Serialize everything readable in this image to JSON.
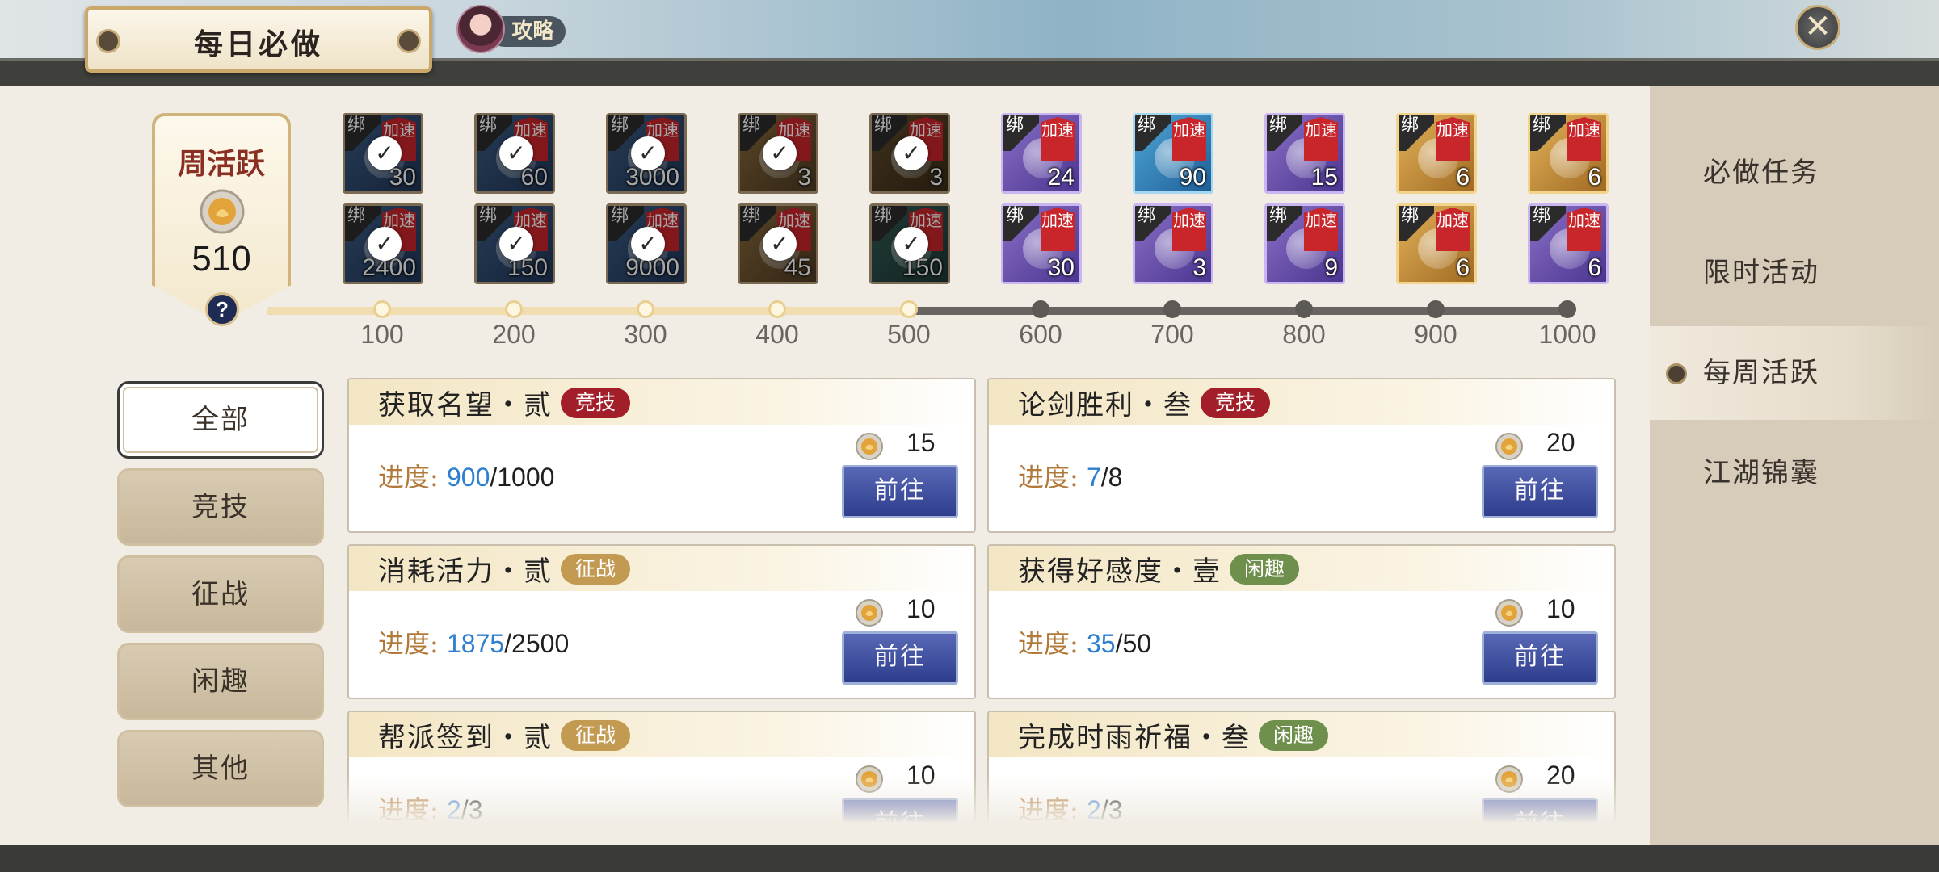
{
  "header": {
    "title": "每日必做",
    "guide_label": "攻略",
    "close_glyph": "✕"
  },
  "nav": {
    "items": [
      {
        "label": "必做任务",
        "active": false
      },
      {
        "label": "限时活动",
        "active": false
      },
      {
        "label": "每周活跃",
        "active": true
      },
      {
        "label": "江湖锦囊",
        "active": false
      }
    ]
  },
  "weekly": {
    "title": "周活跃",
    "value": "510",
    "help": "?"
  },
  "rewards": {
    "bind_label": "绑",
    "speed_label": "加速",
    "row1": [
      {
        "count": "30",
        "style": "blue",
        "claimed": true
      },
      {
        "count": "60",
        "style": "blue",
        "claimed": true
      },
      {
        "count": "3000",
        "style": "blue",
        "claimed": true
      },
      {
        "count": "3",
        "style": "brown",
        "claimed": true
      },
      {
        "count": "3",
        "style": "darkb",
        "claimed": true
      },
      {
        "count": "24",
        "style": "purple",
        "claimed": false
      },
      {
        "count": "90",
        "style": "sky",
        "claimed": false
      },
      {
        "count": "15",
        "style": "purple",
        "claimed": false
      },
      {
        "count": "6",
        "style": "gold",
        "claimed": false
      },
      {
        "count": "6",
        "style": "gold",
        "claimed": false
      }
    ],
    "row2": [
      {
        "count": "2400",
        "style": "blue",
        "claimed": true
      },
      {
        "count": "150",
        "style": "blue",
        "claimed": true
      },
      {
        "count": "9000",
        "style": "blue",
        "claimed": true
      },
      {
        "count": "45",
        "style": "brown",
        "claimed": true
      },
      {
        "count": "150",
        "style": "green",
        "claimed": true
      },
      {
        "count": "30",
        "style": "purple",
        "claimed": false
      },
      {
        "count": "3",
        "style": "purple",
        "claimed": false
      },
      {
        "count": "9",
        "style": "purple",
        "claimed": false
      },
      {
        "count": "6",
        "style": "gold",
        "claimed": false
      },
      {
        "count": "6",
        "style": "purple",
        "claimed": false
      }
    ],
    "check_glyph": "✓"
  },
  "milestones": {
    "current": 510,
    "values": [
      "100",
      "200",
      "300",
      "400",
      "500",
      "600",
      "700",
      "800",
      "900",
      "1000"
    ],
    "reached_count": 5
  },
  "filters": [
    {
      "label": "全部",
      "selected": true
    },
    {
      "label": "竞技",
      "selected": false
    },
    {
      "label": "征战",
      "selected": false
    },
    {
      "label": "闲趣",
      "selected": false
    },
    {
      "label": "其他",
      "selected": false
    }
  ],
  "tasks": {
    "progress_label": "进度:",
    "go_label": "前往",
    "items": [
      {
        "title": "获取名望・贰",
        "tag": "竞技",
        "tag_color": "#a21f2a",
        "current": "900",
        "total": "/1000",
        "points": "15"
      },
      {
        "title": "论剑胜利・叁",
        "tag": "竞技",
        "tag_color": "#a21f2a",
        "current": "7",
        "total": "/8",
        "points": "20"
      },
      {
        "title": "消耗活力・贰",
        "tag": "征战",
        "tag_color": "#c29a52",
        "current": "1875",
        "total": "/2500",
        "points": "10"
      },
      {
        "title": "获得好感度・壹",
        "tag": "闲趣",
        "tag_color": "#6f8f4c",
        "current": "35",
        "total": "/50",
        "points": "10"
      },
      {
        "title": "帮派签到・贰",
        "tag": "征战",
        "tag_color": "#c29a52",
        "current": "2",
        "total": "/3",
        "points": "10"
      },
      {
        "title": "完成时雨祈福・叁",
        "tag": "闲趣",
        "tag_color": "#6f8f4c",
        "current": "2",
        "total": "/3",
        "points": "20"
      }
    ]
  },
  "colors": {
    "accent_red": "#a21f2a",
    "progress_blue": "#2e7fcf",
    "go_button": "#3a4a9a"
  }
}
